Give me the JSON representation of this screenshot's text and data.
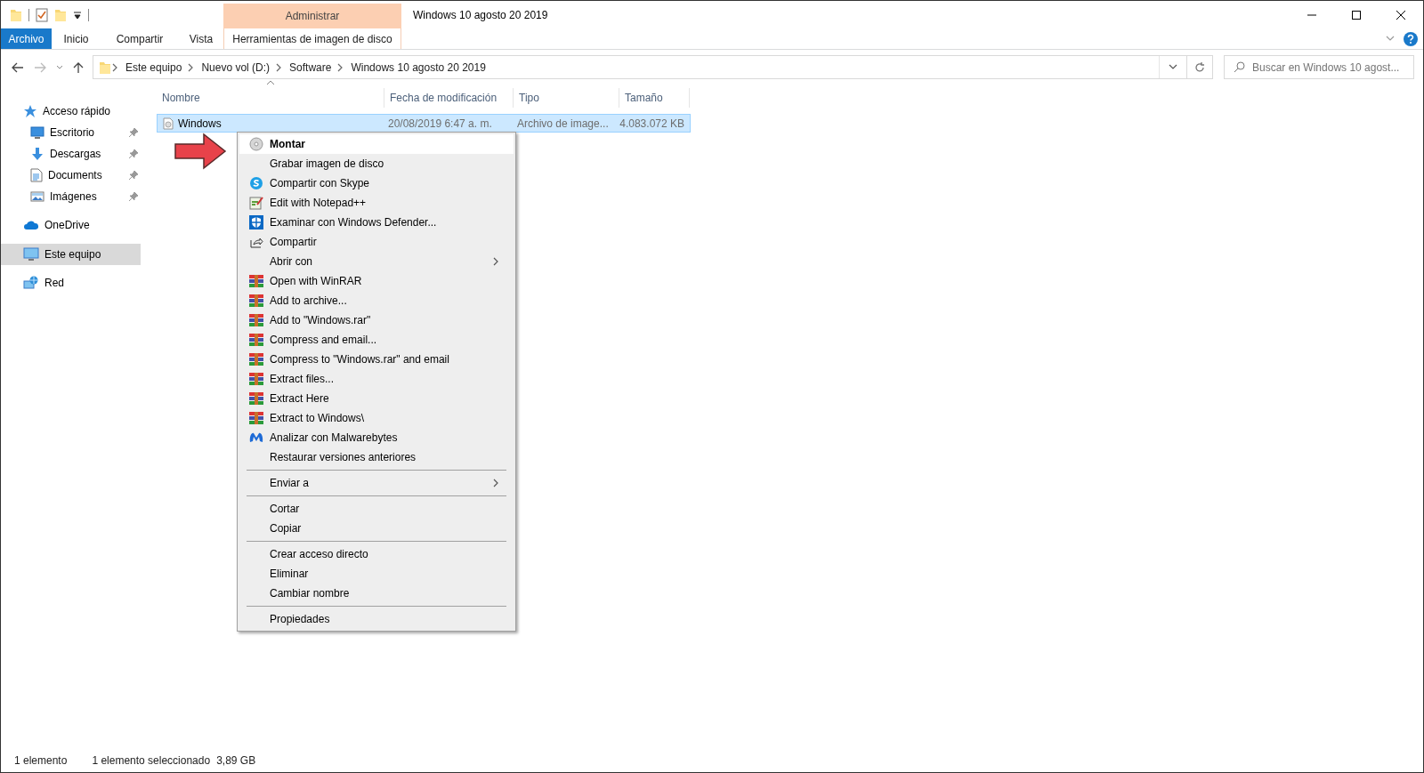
{
  "window": {
    "title": "Windows 10 agosto 20 2019"
  },
  "ribbon": {
    "contextual_group": "Administrar",
    "tabs": [
      {
        "label": "Archivo",
        "kind": "file",
        "selected": false
      },
      {
        "label": "Inicio",
        "kind": "plain",
        "selected": false
      },
      {
        "label": "Compartir",
        "kind": "plain",
        "selected": false
      },
      {
        "label": "Vista",
        "kind": "plain",
        "selected": false
      },
      {
        "label": "Herramientas de imagen de disco",
        "kind": "contextual",
        "selected": false
      }
    ]
  },
  "address_bar": {
    "breadcrumbs": [
      "Este equipo",
      "Nuevo vol (D:)",
      "Software",
      "Windows 10 agosto 20 2019"
    ]
  },
  "search": {
    "placeholder": "Buscar en Windows 10 agost..."
  },
  "sidebar": {
    "items": [
      {
        "label": "Acceso rápido",
        "kind": "star",
        "selected": false,
        "pinned": false,
        "children": [
          {
            "label": "Escritorio",
            "kind": "desktop",
            "selected": false,
            "pinned": true
          },
          {
            "label": "Descargas",
            "kind": "download",
            "selected": false,
            "pinned": true
          },
          {
            "label": "Documents",
            "kind": "document",
            "selected": false,
            "pinned": true
          },
          {
            "label": "Imágenes",
            "kind": "pictures",
            "selected": false,
            "pinned": true
          }
        ]
      },
      {
        "label": "OneDrive",
        "kind": "cloud",
        "selected": false,
        "pinned": false
      },
      {
        "label": "Este equipo",
        "kind": "computer",
        "selected": true,
        "pinned": false
      },
      {
        "label": "Red",
        "kind": "network",
        "selected": false,
        "pinned": false
      }
    ]
  },
  "file_list": {
    "columns": [
      {
        "label": "Nombre",
        "sorted": true
      },
      {
        "label": "Fecha de modificación",
        "sorted": false
      },
      {
        "label": "Tipo",
        "sorted": false
      },
      {
        "label": "Tamaño",
        "sorted": false
      }
    ],
    "rows": [
      {
        "cells": [
          "Windows",
          "20/08/2019 6:47 a. m.",
          "Archivo de image...",
          "4.083.072 KB"
        ],
        "selected": true
      }
    ]
  },
  "context_menu": {
    "groups": [
      [
        {
          "label": "Montar",
          "kind": "disc",
          "default": true,
          "highlighted": true,
          "submenu": false
        },
        {
          "label": "Grabar imagen de disco",
          "kind": "plain",
          "default": false,
          "highlighted": false,
          "submenu": false
        },
        {
          "label": "Compartir con Skype",
          "kind": "skype",
          "default": false,
          "highlighted": false,
          "submenu": false
        },
        {
          "label": "Edit with Notepad++",
          "kind": "notepad",
          "default": false,
          "highlighted": false,
          "submenu": false
        },
        {
          "label": "Examinar con Windows Defender...",
          "kind": "shield",
          "default": false,
          "highlighted": false,
          "submenu": false
        },
        {
          "label": "Compartir",
          "kind": "share",
          "default": false,
          "highlighted": false,
          "submenu": false
        },
        {
          "label": "Abrir con",
          "kind": "plain",
          "default": false,
          "highlighted": false,
          "submenu": true
        },
        {
          "label": "Open with WinRAR",
          "kind": "winrar",
          "default": false,
          "highlighted": false,
          "submenu": false
        },
        {
          "label": "Add to archive...",
          "kind": "winrar",
          "default": false,
          "highlighted": false,
          "submenu": false
        },
        {
          "label": "Add to \"Windows.rar\"",
          "kind": "winrar",
          "default": false,
          "highlighted": false,
          "submenu": false
        },
        {
          "label": "Compress and email...",
          "kind": "winrar",
          "default": false,
          "highlighted": false,
          "submenu": false
        },
        {
          "label": "Compress to \"Windows.rar\" and email",
          "kind": "winrar",
          "default": false,
          "highlighted": false,
          "submenu": false
        },
        {
          "label": "Extract files...",
          "kind": "winrar",
          "default": false,
          "highlighted": false,
          "submenu": false
        },
        {
          "label": "Extract Here",
          "kind": "winrar",
          "default": false,
          "highlighted": false,
          "submenu": false
        },
        {
          "label": "Extract to Windows\\",
          "kind": "winrar",
          "default": false,
          "highlighted": false,
          "submenu": false
        },
        {
          "label": "Analizar con Malwarebytes",
          "kind": "malware",
          "default": false,
          "highlighted": false,
          "submenu": false
        },
        {
          "label": "Restaurar versiones anteriores",
          "kind": "plain",
          "default": false,
          "highlighted": false,
          "submenu": false
        }
      ],
      [
        {
          "label": "Enviar a",
          "kind": "plain",
          "default": false,
          "highlighted": false,
          "submenu": true
        }
      ],
      [
        {
          "label": "Cortar",
          "kind": "plain",
          "default": false,
          "highlighted": false,
          "submenu": false
        },
        {
          "label": "Copiar",
          "kind": "plain",
          "default": false,
          "highlighted": false,
          "submenu": false
        }
      ],
      [
        {
          "label": "Crear acceso directo",
          "kind": "plain",
          "default": false,
          "highlighted": false,
          "submenu": false
        },
        {
          "label": "Eliminar",
          "kind": "plain",
          "default": false,
          "highlighted": false,
          "submenu": false
        },
        {
          "label": "Cambiar nombre",
          "kind": "plain",
          "default": false,
          "highlighted": false,
          "submenu": false
        }
      ],
      [
        {
          "label": "Propiedades",
          "kind": "plain",
          "default": false,
          "highlighted": false,
          "submenu": false
        }
      ]
    ]
  },
  "status_bar": {
    "item_count": "1 elemento",
    "selection": "1 elemento seleccionado",
    "size": "3,89 GB"
  }
}
